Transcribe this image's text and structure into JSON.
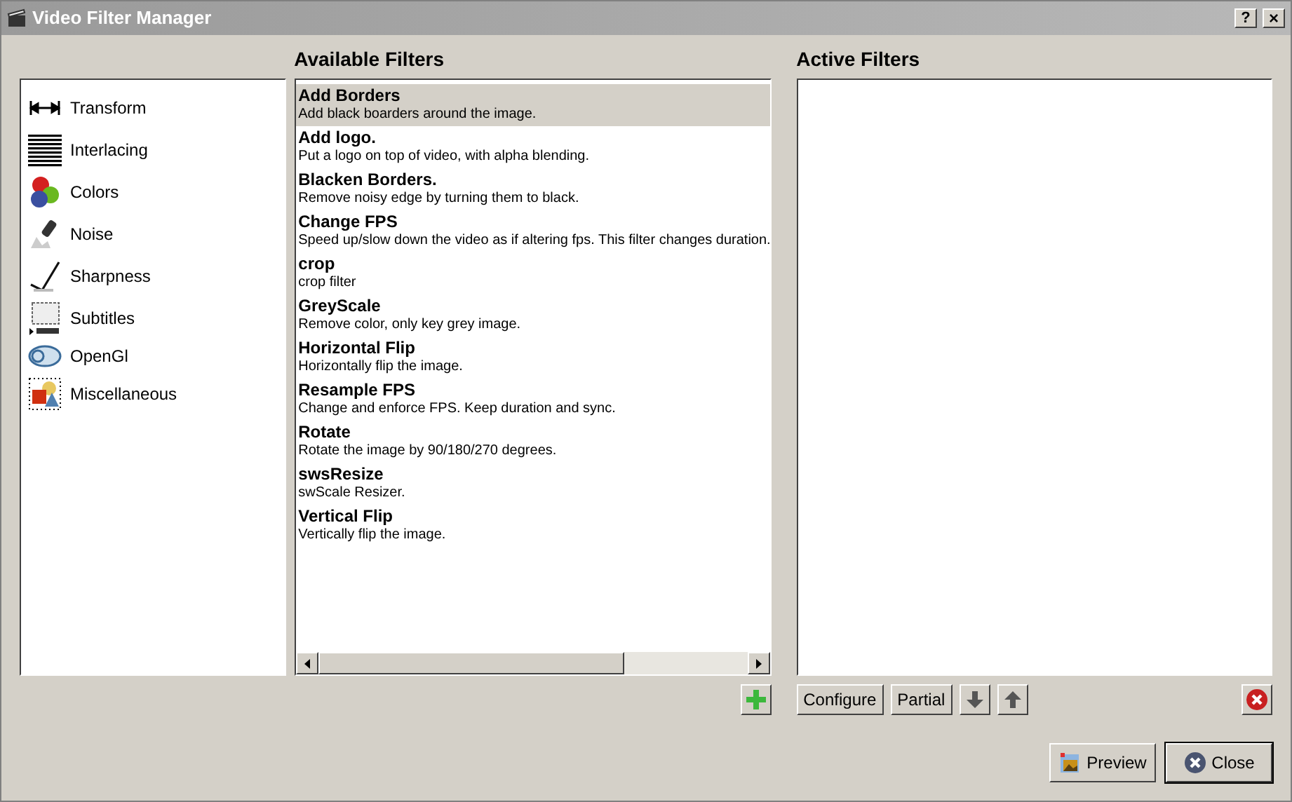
{
  "window": {
    "title": "Video Filter Manager",
    "help_button": "?",
    "close_button": "×"
  },
  "categories": [
    {
      "label": "Transform"
    },
    {
      "label": "Interlacing"
    },
    {
      "label": "Colors"
    },
    {
      "label": "Noise"
    },
    {
      "label": "Sharpness"
    },
    {
      "label": "Subtitles"
    },
    {
      "label": "OpenGl"
    },
    {
      "label": "Miscellaneous"
    }
  ],
  "available_filters": {
    "title": "Available Filters",
    "items": [
      {
        "name": "Add Borders",
        "description": "Add black boarders around the image.",
        "selected": true
      },
      {
        "name": "Add logo.",
        "description": "Put a logo on top of video, with alpha blending.",
        "selected": false
      },
      {
        "name": "Blacken Borders.",
        "description": "Remove noisy edge by turning them to black.",
        "selected": false
      },
      {
        "name": "Change FPS",
        "description": "Speed up/slow down the video as if altering fps. This filter changes duration.",
        "selected": false
      },
      {
        "name": "crop",
        "description": "crop filter",
        "selected": false
      },
      {
        "name": "GreyScale",
        "description": "Remove color, only key grey image.",
        "selected": false
      },
      {
        "name": "Horizontal Flip",
        "description": "Horizontally flip the image.",
        "selected": false
      },
      {
        "name": "Resample FPS",
        "description": "Change and enforce FPS. Keep duration and sync.",
        "selected": false
      },
      {
        "name": "Rotate",
        "description": "Rotate the image by 90/180/270 degrees.",
        "selected": false
      },
      {
        "name": "swsResize",
        "description": "swScale Resizer.",
        "selected": false
      },
      {
        "name": "Vertical Flip",
        "description": "Vertically flip the image.",
        "selected": false
      }
    ]
  },
  "active_filters": {
    "title": "Active Filters"
  },
  "buttons": {
    "configure": "Configure",
    "partial": "Partial",
    "preview": "Preview",
    "close": "Close"
  }
}
